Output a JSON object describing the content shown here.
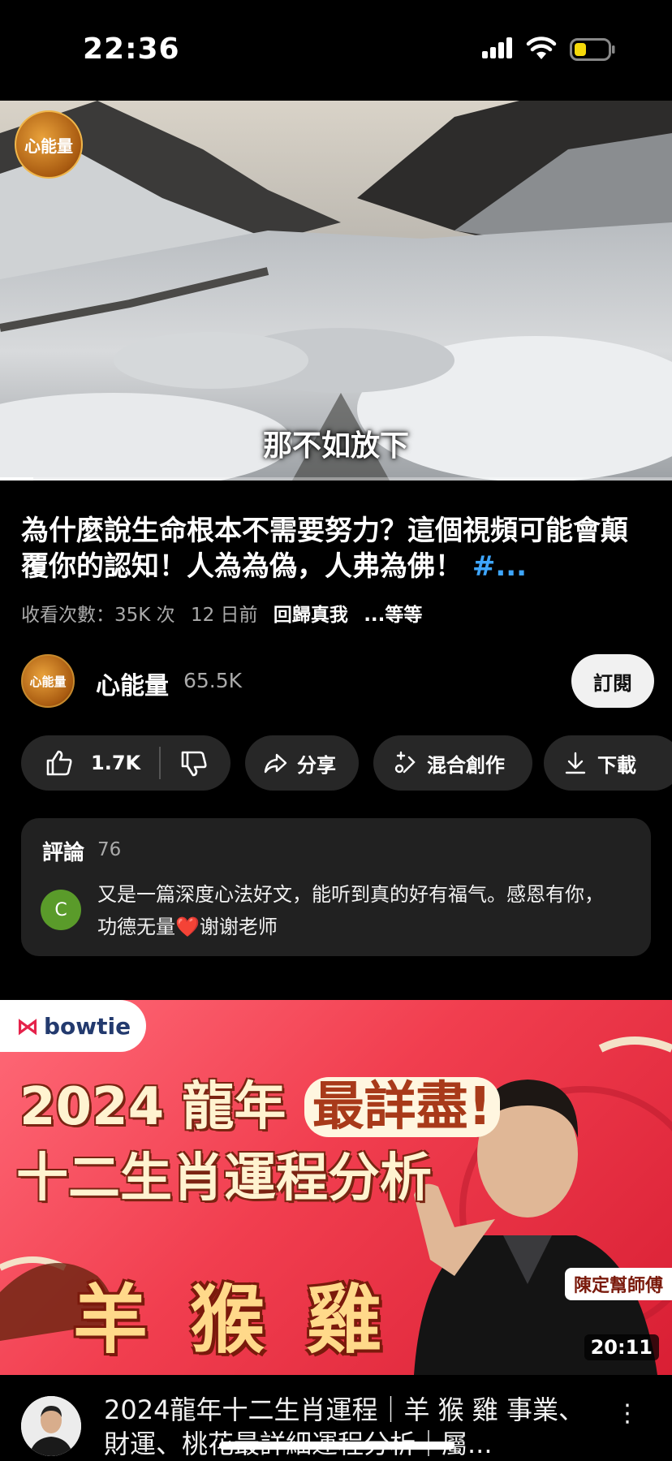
{
  "status_bar": {
    "time": "22:36"
  },
  "video": {
    "channel_watermark": "心能量",
    "subtitle": "那不如放下",
    "progress": 0.05
  },
  "details": {
    "title": "為什麼說生命根本不需要努力？這個視頻可能會顛覆你的認知！人為為偽，人弗為佛！",
    "title_hashtag": "#...",
    "views": "收看次數：35K 次",
    "age": "12 日前",
    "tag": "回歸真我",
    "more": "...等等"
  },
  "channel": {
    "avatar_text": "心能量",
    "name": "心能量",
    "subscribers": "65.5K",
    "subscribe_label": "訂閱"
  },
  "actions": {
    "likes": "1.7K",
    "share": "分享",
    "remix": "混合創作",
    "download": "下載"
  },
  "comments": {
    "header": "評論",
    "count": "76",
    "avatar_letter": "C",
    "top_comment_a": "又是一篇深度心法好文，能听到真的好有福气。感恩有你，功德无量",
    "top_comment_b": "谢谢老师"
  },
  "ad": {
    "brand": "bowtie",
    "line1_year": "2024 龍年",
    "line1_highlight": "最詳盡!",
    "line2": "十二生肖運程分析",
    "line3": "羊猴雞",
    "presenter": "陳定幫師傅",
    "duration": "20:11"
  },
  "next_video": {
    "title": "2024龍年十二生肖運程｜羊 猴 雞 事業、財運、桃花最詳細運程分析｜屬...",
    "more_icon": "⋮"
  },
  "colors": {
    "link": "#3ea6ff",
    "background": "#000000",
    "card": "#212121",
    "pill": "#272727"
  }
}
